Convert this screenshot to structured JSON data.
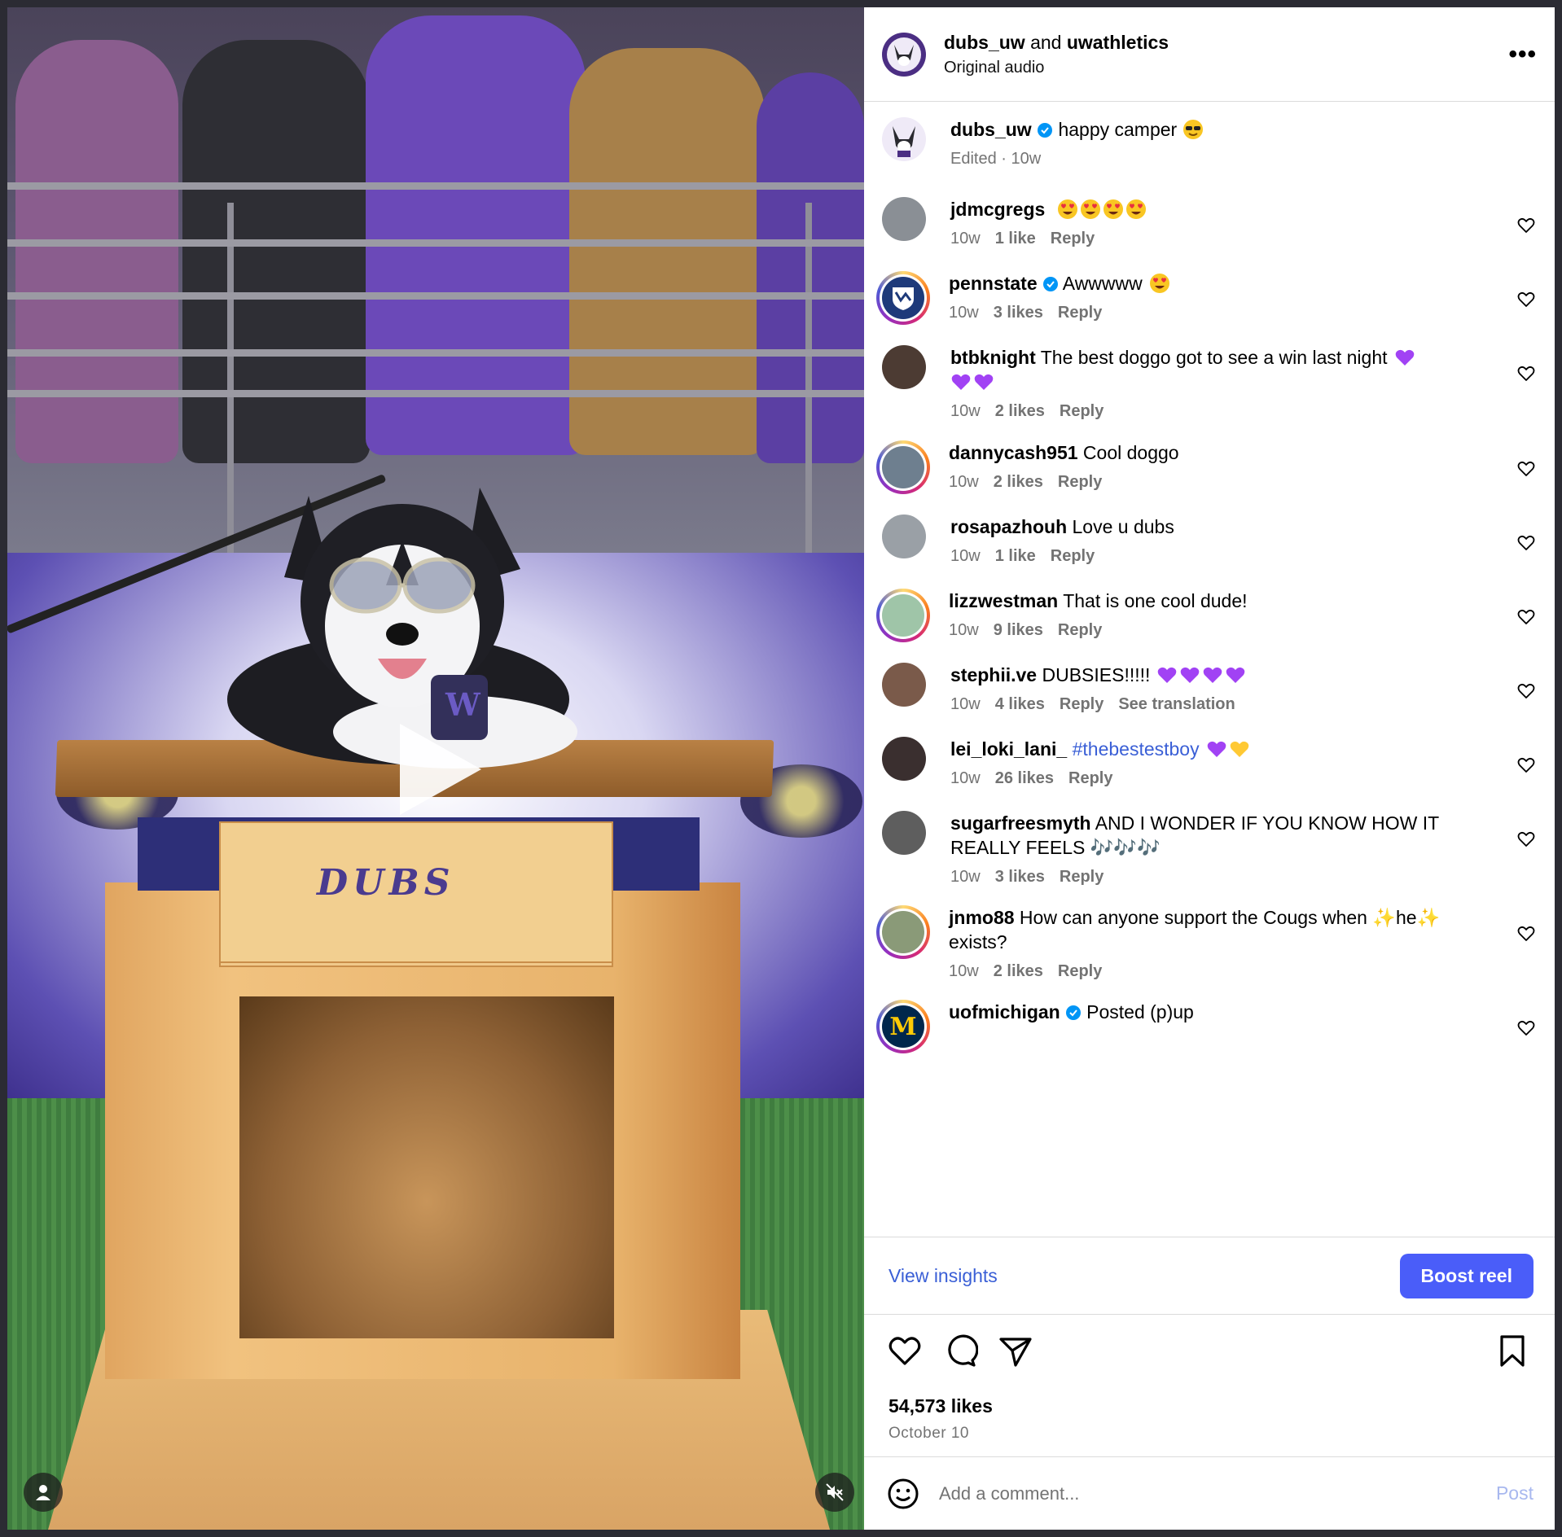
{
  "header": {
    "user1": "dubs_uw",
    "joiner": "and",
    "user2": "uwathletics",
    "subtitle": "Original audio",
    "more_icon": "more-horizontal-icon"
  },
  "video": {
    "crate_text": "DUBS",
    "play_icon": "play-icon",
    "mute_icon": "muted-speaker-icon",
    "profile_icon": "user-silhouette-icon"
  },
  "caption": {
    "user": "dubs_uw",
    "text": "happy camper",
    "emoji": "sunglasses-face",
    "meta": "Edited · 10w"
  },
  "comments": [
    {
      "user": "jdmcgregs",
      "text": "",
      "emojis": [
        "heart-eyes",
        "heart-eyes",
        "heart-eyes",
        "heart-eyes"
      ],
      "time": "10w",
      "likes": "1 like",
      "reply": "Reply",
      "ring": false,
      "verified": false,
      "avatar_color": "#8a8f95"
    },
    {
      "user": "pennstate",
      "text": "Awwwww",
      "emojis": [
        "heart-eyes"
      ],
      "time": "10w",
      "likes": "3 likes",
      "reply": "Reply",
      "ring": true,
      "verified": true,
      "avatar_color": "#1e3a7a"
    },
    {
      "user": "btbknight",
      "text": "The best doggo got to see a win last night",
      "emojis": [
        "purple-heart"
      ],
      "emojis2": [
        "purple-heart",
        "purple-heart"
      ],
      "time": "10w",
      "likes": "2 likes",
      "reply": "Reply",
      "ring": false,
      "verified": false,
      "avatar_color": "#4c3b33"
    },
    {
      "user": "dannycash951",
      "text": "Cool doggo",
      "emojis": [],
      "time": "10w",
      "likes": "2 likes",
      "reply": "Reply",
      "ring": true,
      "verified": false,
      "avatar_color": "#6e7f8f"
    },
    {
      "user": "rosapazhouh",
      "text": "Love u dubs",
      "emojis": [],
      "time": "10w",
      "likes": "1 like",
      "reply": "Reply",
      "ring": false,
      "verified": false,
      "avatar_color": "#9aa0a6"
    },
    {
      "user": "lizzwestman",
      "text": "That is one cool dude!",
      "emojis": [],
      "time": "10w",
      "likes": "9 likes",
      "reply": "Reply",
      "ring": true,
      "verified": false,
      "avatar_color": "#9fc5a8"
    },
    {
      "user": "stephii.ve",
      "text": "DUBSIES!!!!!",
      "emojis": [
        "purple-heart",
        "purple-heart",
        "purple-heart",
        "purple-heart"
      ],
      "time": "10w",
      "likes": "4 likes",
      "reply": "Reply",
      "extra": "See translation",
      "ring": false,
      "verified": false,
      "avatar_color": "#7a5a4a"
    },
    {
      "user": "lei_loki_lani_",
      "text": "",
      "hashtag": "#thebestestboy",
      "emojis": [
        "purple-heart",
        "yellow-heart"
      ],
      "time": "10w",
      "likes": "26 likes",
      "reply": "Reply",
      "ring": false,
      "verified": false,
      "avatar_color": "#3a2f2f"
    },
    {
      "user": "sugarfreesmyth",
      "text": "AND I WONDER IF YOU KNOW HOW IT REALLY FEELS",
      "tail": "🎶🎶🎶",
      "emojis": [],
      "time": "10w",
      "likes": "3 likes",
      "reply": "Reply",
      "ring": false,
      "verified": false,
      "avatar_color": "#5e5e5e"
    },
    {
      "user": "jnmo88",
      "text": "How can anyone support the Cougs when",
      "tail": "✨he✨ exists?",
      "emojis": [],
      "time": "10w",
      "likes": "2 likes",
      "reply": "Reply",
      "ring": true,
      "verified": false,
      "avatar_color": "#8a9a78"
    },
    {
      "user": "uofmichigan",
      "text": "Posted (p)up",
      "emojis": [],
      "time": "",
      "likes": "",
      "reply": "",
      "ring": true,
      "verified": true,
      "avatar_color": "#00274c"
    }
  ],
  "footer": {
    "view_insights": "View insights",
    "boost_label": "Boost reel",
    "likes": "54,573 likes",
    "date": "October 10",
    "comment_placeholder": "Add a comment...",
    "post_label": "Post"
  },
  "colors": {
    "accent": "#4a5df9",
    "link": "#3a5fd6",
    "muted": "#737373",
    "uw_purple": "#4b2e83"
  }
}
